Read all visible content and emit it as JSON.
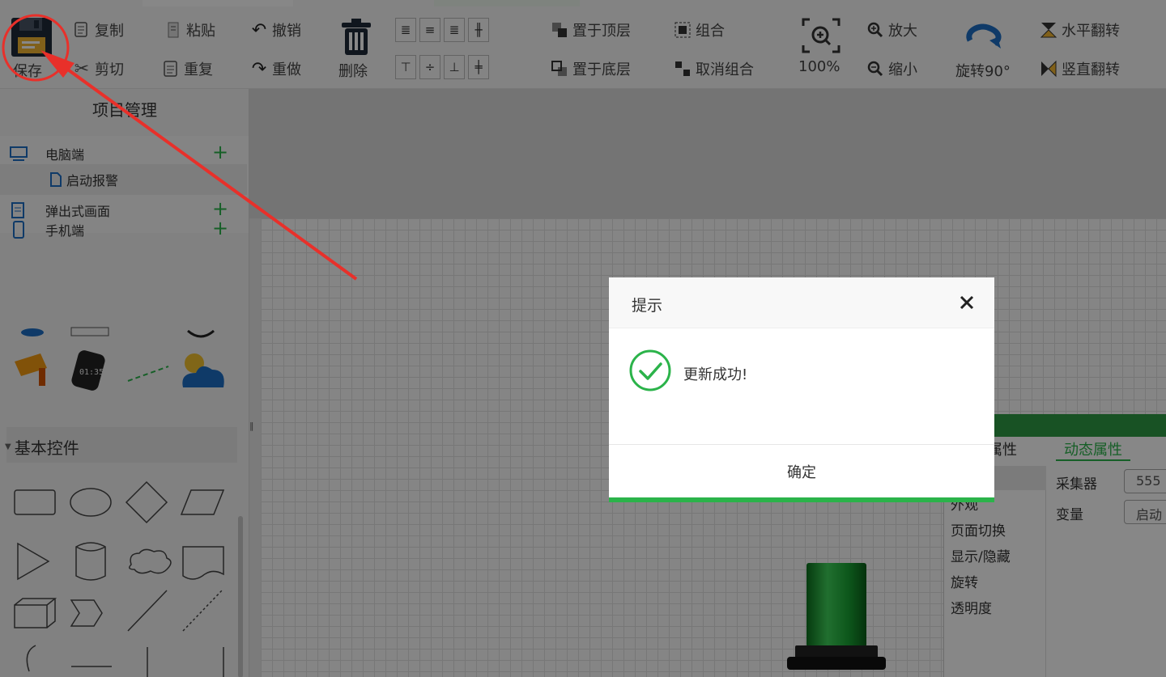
{
  "toolbar": {
    "save": "保存",
    "copy": "复制",
    "paste": "粘贴",
    "undo": "撤销",
    "cut": "剪切",
    "repeat": "重复",
    "redo": "重做",
    "delete": "删除",
    "bring_to_top": "置于顶层",
    "send_to_bottom": "置于底层",
    "group": "组合",
    "ungroup": "取消组合",
    "zoom_level": "100%",
    "zoom_in": "放大",
    "zoom_out": "缩小",
    "rotate": "旋转90°",
    "flip_h": "水平翻转",
    "flip_v": "竖直翻转"
  },
  "left_panel": {
    "title": "项目管理",
    "tree": [
      {
        "label": "电脑端",
        "icon": "monitor-icon"
      },
      {
        "label": "启动报警",
        "icon": "page-icon"
      },
      {
        "label": "弹出式画面",
        "icon": "popup-icon"
      },
      {
        "label": "手机端",
        "icon": "phone-icon"
      }
    ],
    "controls_section": "基本控件"
  },
  "properties": {
    "tab_static": "属性",
    "tab_dynamic": "动态属性",
    "items": [
      "外观",
      "页面切换",
      "显示/隐藏",
      "旋转",
      "透明度"
    ],
    "collector_label": "采集器",
    "collector_value": "555",
    "variable_label": "变量",
    "variable_value": "启动"
  },
  "dialog": {
    "title": "提示",
    "message": "更新成功!",
    "ok": "确定"
  },
  "colors": {
    "accent": "#2bb34a",
    "annotation": "#e8302a"
  }
}
